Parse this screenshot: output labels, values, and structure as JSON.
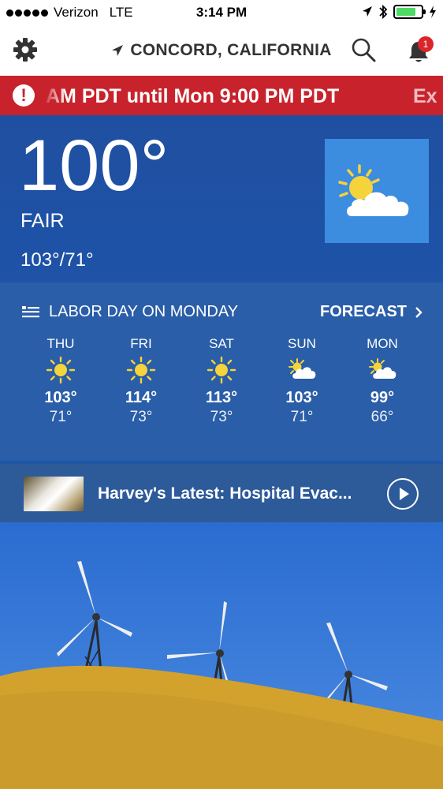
{
  "status_bar": {
    "carrier": "Verizon",
    "network": "LTE",
    "time": "3:14 PM",
    "battery_level": 0.8
  },
  "header": {
    "location": "CONCORD, CALIFORNIA",
    "notification_count": "1"
  },
  "alert": {
    "text": "AM PDT until Mon 9:00 PM PDT",
    "next_text": "Ex"
  },
  "current": {
    "temperature": "100°",
    "phrase": "FAIR",
    "hi_lo": "103°/71°",
    "icon": "partly-sunny-icon"
  },
  "forecast": {
    "holiday": "LABOR DAY ON MONDAY",
    "link_label": "FORECAST",
    "days": [
      {
        "name": "THU",
        "hi": "103°",
        "lo": "71°",
        "icon": "sun-icon"
      },
      {
        "name": "FRI",
        "hi": "114°",
        "lo": "73°",
        "icon": "sun-icon"
      },
      {
        "name": "SAT",
        "hi": "113°",
        "lo": "73°",
        "icon": "sun-icon"
      },
      {
        "name": "SUN",
        "hi": "103°",
        "lo": "71°",
        "icon": "partly-cloudy-icon"
      },
      {
        "name": "MON",
        "hi": "99°",
        "lo": "66°",
        "icon": "partly-cloudy-icon"
      }
    ]
  },
  "video": {
    "title": "Harvey's Latest: Hospital Evac..."
  },
  "colors": {
    "alert_red": "#c8232c",
    "sky_blue": "#1f56a6",
    "badge_red": "#d9252b",
    "sun_yellow": "#f5d33b"
  }
}
